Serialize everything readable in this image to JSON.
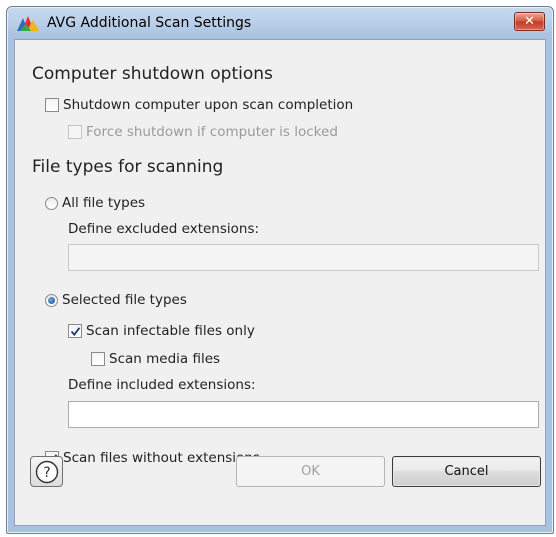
{
  "window": {
    "title": "AVG Additional Scan Settings",
    "close_glyph": "✕"
  },
  "shutdown": {
    "heading": "Computer shutdown options",
    "shutdown_on_completion": {
      "label": "Shutdown computer upon scan completion",
      "checked": false
    },
    "force_shutdown_locked": {
      "label": "Force shutdown if computer is locked",
      "checked": false,
      "enabled": false
    }
  },
  "file_types": {
    "heading": "File types for scanning",
    "all_file_types": {
      "label": "All file types",
      "selected": false
    },
    "excluded_extensions": {
      "label": "Define excluded extensions:",
      "value": ""
    },
    "selected_file_types": {
      "label": "Selected file types",
      "selected": true
    },
    "infectable_only": {
      "label": "Scan infectable files only",
      "checked": true
    },
    "media_files": {
      "label": "Scan media files",
      "checked": false
    },
    "included_extensions": {
      "label": "Define included extensions:",
      "value": ""
    },
    "without_extensions": {
      "label": "Scan files without extensions",
      "checked": true
    }
  },
  "buttons": {
    "help_glyph": "?",
    "ok": "OK",
    "cancel": "Cancel"
  },
  "colors": {
    "titlebar": "#bcd1ea",
    "client": "#f0f0f0",
    "close": "#c0391f",
    "radio_dot": "#1c4f91"
  }
}
